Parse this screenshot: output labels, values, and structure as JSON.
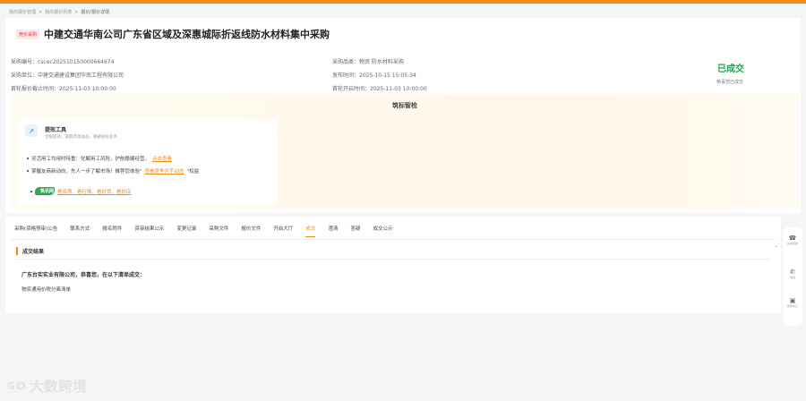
{
  "breadcrumb": [
    "我的报价管理",
    "我的报价列表",
    "报价/报价详情"
  ],
  "header": {
    "badge": "竞价采购",
    "title": "中建交通华南公司广东省区域及深惠城际折返线防水材料集中采购"
  },
  "info": {
    "code": "采购编号：cscec202510150000664674",
    "unit": "采购单位：中建交通建设集团华南工程有限公司",
    "deadline": "首轮报价截止时间：2025-11-03 10:00:00",
    "category": "采购品类：物资 防水材料采购",
    "publish": "发布时间：2025-10-15 15:05:34",
    "open": "首轮开启时间：2025-11-03 10:00:00"
  },
  "status": {
    "label": "已成交",
    "sub": "恭喜您已成交"
  },
  "smart": {
    "title": "筑标智检",
    "tool_name": "提效工具",
    "tool_desc": "合规提效，掌握市场动态，规避投标业务",
    "bullet1_text": "灵活用工均用时待重：化解用工风险，护航稳健经营。",
    "bullet1_link": "点击查看",
    "bullet2_text": "掌握友商新动向，先人一步了解市场！推荐您体验\"",
    "bullet2_link": "查看竞争对手动态",
    "bullet2_tail": "\"权益",
    "logo_text": "筑讯网",
    "logo_links": "看资质、看行情、看好货、看好店"
  },
  "tabs": [
    "采购(资格预审)公告",
    "联系方式",
    "报名附件",
    "资审结果公示",
    "变更记录",
    "采购文件",
    "报价文件",
    "开启大厅",
    "成交",
    "澄清",
    "答疑",
    "成交公示"
  ],
  "active_tab": "成交",
  "result": {
    "section_title": "成交结果",
    "winner_text": "广东台实实业有限公司，恭喜您，在以下清单成交：",
    "item_text": "物资通用价税分离清单"
  },
  "sidebar": {
    "service_label": "在线客服",
    "phone_label": "电话",
    "help_label": "帮助中心"
  },
  "watermark": {
    "logo": "ɢ໐",
    "text": "大数跨境"
  }
}
